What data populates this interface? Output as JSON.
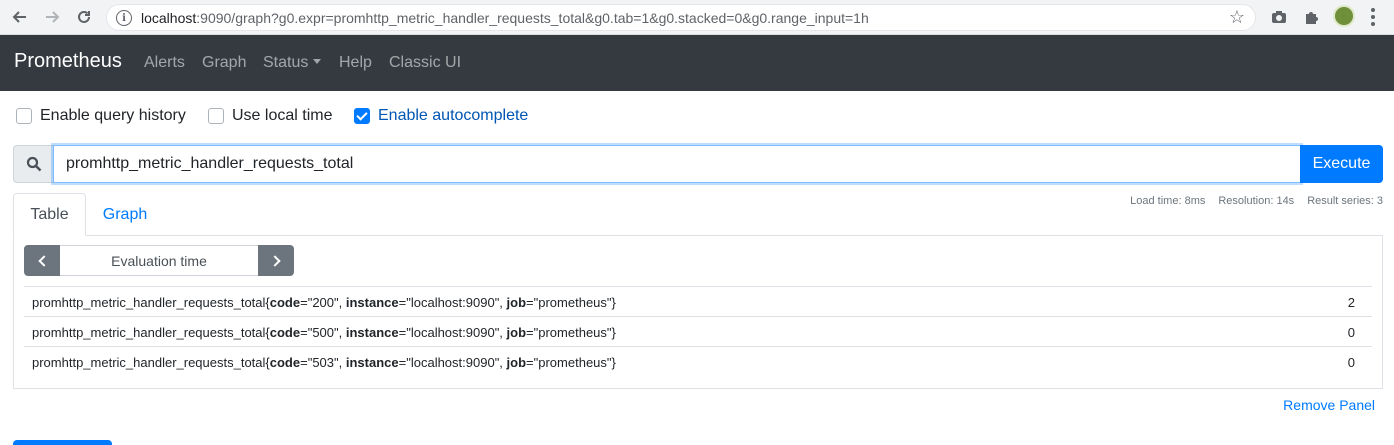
{
  "browser": {
    "url_host": "localhost",
    "url_rest": ":9090/graph?g0.expr=promhttp_metric_handler_requests_total&g0.tab=1&g0.stacked=0&g0.range_input=1h"
  },
  "navbar": {
    "brand": "Prometheus",
    "links": [
      "Alerts",
      "Graph",
      "Status",
      "Help",
      "Classic UI"
    ]
  },
  "options": {
    "query_history": {
      "label": "Enable query history",
      "checked": false
    },
    "local_time": {
      "label": "Use local time",
      "checked": false
    },
    "autocomplete": {
      "label": "Enable autocomplete",
      "checked": true
    }
  },
  "query": {
    "expression": "promhttp_metric_handler_requests_total",
    "execute_label": "Execute"
  },
  "stats": {
    "load_time": "Load time: 8ms",
    "resolution": "Resolution: 14s",
    "result_series": "Result series: 3"
  },
  "tabs": [
    "Table",
    "Graph"
  ],
  "eval": {
    "placeholder": "Evaluation time"
  },
  "results": [
    {
      "metric": "promhttp_metric_handler_requests_total",
      "code": "200",
      "instance": "localhost:9090",
      "job": "prometheus",
      "value": "2"
    },
    {
      "metric": "promhttp_metric_handler_requests_total",
      "code": "500",
      "instance": "localhost:9090",
      "job": "prometheus",
      "value": "0"
    },
    {
      "metric": "promhttp_metric_handler_requests_total",
      "code": "503",
      "instance": "localhost:9090",
      "job": "prometheus",
      "value": "0"
    }
  ],
  "remove_panel": "Remove Panel",
  "colors": {
    "navbar": "#343a40",
    "primary": "#007bff",
    "secondary": "#6c757d"
  }
}
